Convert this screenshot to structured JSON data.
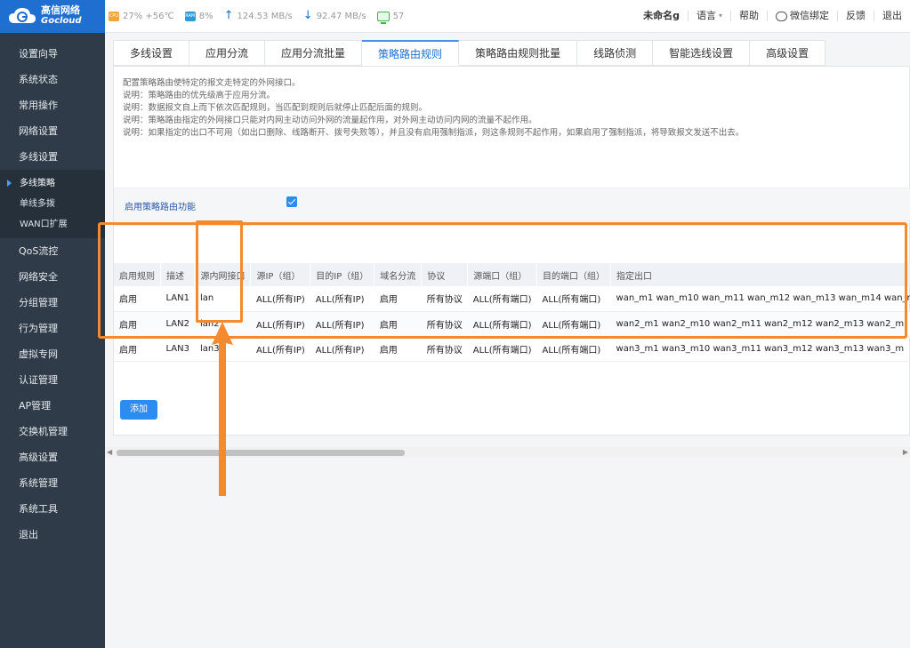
{
  "brand": {
    "name_cn": "高信网络",
    "name_en": "Gocloud"
  },
  "stats": {
    "cpu_chip": "CPU",
    "cpu": "27% +56℃",
    "ram_chip": "RAM",
    "ram": "8%",
    "up": "124.53 MB/s",
    "down": "92.47 MB/s",
    "online": "57"
  },
  "topright": {
    "user": "未命名g",
    "language": "语言",
    "help": "帮助",
    "wechat": "微信绑定",
    "feedback": "反馈",
    "logout": "退出"
  },
  "sidebar": {
    "items_top": [
      "设置向导",
      "系统状态",
      "常用操作",
      "网络设置",
      "多线设置"
    ],
    "group": [
      "多线策略",
      "单线多拨",
      "WAN口扩展"
    ],
    "items_bottom": [
      "QoS流控",
      "网络安全",
      "分组管理",
      "行为管理",
      "虚拟专网",
      "认证管理",
      "AP管理",
      "交换机管理",
      "高级设置",
      "系统管理",
      "系统工具",
      "退出"
    ]
  },
  "tabs": [
    "多线设置",
    "应用分流",
    "应用分流批量",
    "策略路由规则",
    "策略路由规则批量",
    "线路侦测",
    "智能选线设置",
    "高级设置"
  ],
  "description": [
    "配置策略路由使特定的报文走特定的外网接口。",
    "说明：策略路由的优先级高于应用分流。",
    "说明：数据报文自上而下依次匹配规则，当匹配到规则后就停止匹配后面的规则。",
    "说明：策略路由指定的外网接口只能对内网主动访问外网的流量起作用，对外网主动访问内网的流量不起作用。",
    "说明：如果指定的出口不可用（如出口删除、线路断开、拨号失败等），并且没有启用强制指派，则这条规则不起作用，如果启用了强制指派，将导致报文发送不出去。"
  ],
  "enable": {
    "label": "启用策略路由功能",
    "checked": true
  },
  "table": {
    "headers": [
      "启用规则",
      "描述",
      "源内网接口",
      "源IP（组）",
      "目的IP（组）",
      "域名分流",
      "协议",
      "源端口（组）",
      "目的端口（组）",
      "指定出口"
    ],
    "rows": [
      [
        "启用",
        "LAN1",
        "lan",
        "ALL(所有IP)",
        "ALL(所有IP)",
        "启用",
        "所有协议",
        "ALL(所有端口)",
        "ALL(所有端口)",
        "wan_m1 wan_m10 wan_m11 wan_m12 wan_m13 wan_m14 wan_m"
      ],
      [
        "启用",
        "LAN2",
        "lan2",
        "ALL(所有IP)",
        "ALL(所有IP)",
        "启用",
        "所有协议",
        "ALL(所有端口)",
        "ALL(所有端口)",
        "wan2_m1 wan2_m10 wan2_m11 wan2_m12 wan2_m13 wan2_m"
      ],
      [
        "启用",
        "LAN3",
        "lan3",
        "ALL(所有IP)",
        "ALL(所有IP)",
        "启用",
        "所有协议",
        "ALL(所有端口)",
        "ALL(所有端口)",
        "wan3_m1 wan3_m10 wan3_m11 wan3_m12 wan3_m13 wan3_m"
      ]
    ]
  },
  "add_button": "添加",
  "colors": {
    "accent": "#2d8cf0",
    "sidebar": "#2f3b48",
    "annotation": "#f48a2e"
  }
}
